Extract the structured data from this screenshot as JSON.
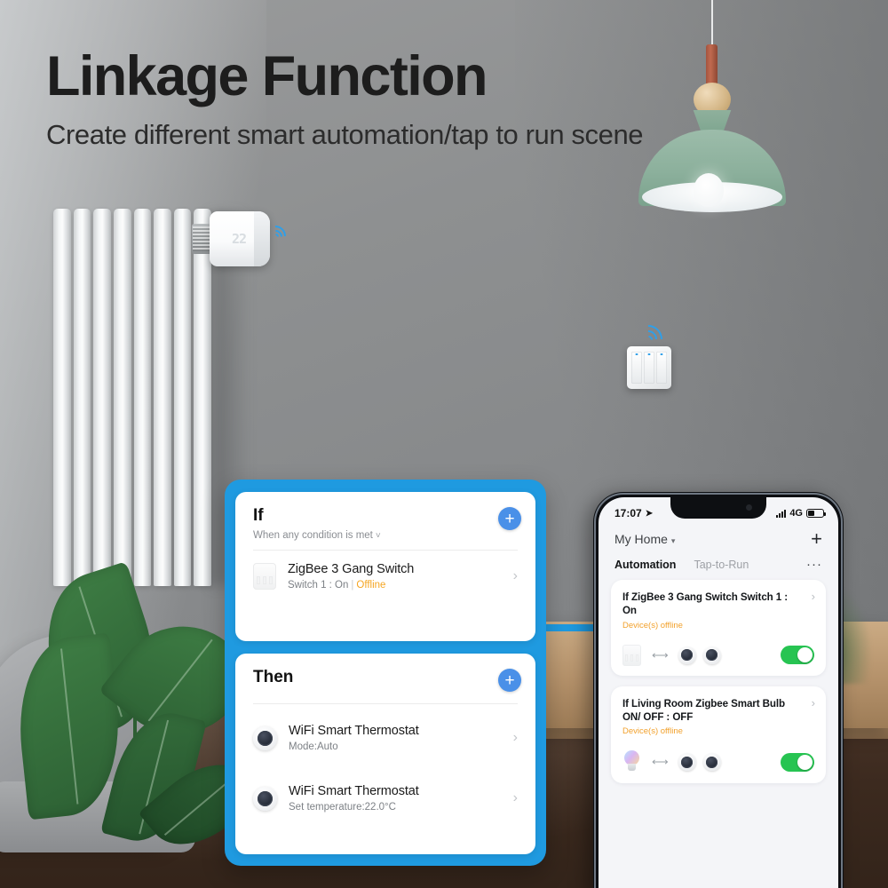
{
  "header": {
    "title": "Linkage Function",
    "subtitle": "Create different smart automation/tap to run scene"
  },
  "scene": {
    "trv_display": "22",
    "wifi_icon": "wifi-icon",
    "wall_switch_icon": "wall-switch-icon",
    "lamp_icon": "pendant-lamp"
  },
  "colors": {
    "accent_blue": "#1f9ae0",
    "plus_blue": "#4a90e8",
    "offline_orange": "#f5a623",
    "toggle_green": "#27c452"
  },
  "blue_panel": {
    "if_card": {
      "title": "If",
      "subtitle": "When any condition is met",
      "chevron": "˅",
      "add_label": "+",
      "rows": [
        {
          "icon": "zigbee-3-gang-switch-icon",
          "title": "ZigBee 3 Gang Switch",
          "sub_main": "Switch 1 : On",
          "sub_sep": "|",
          "sub_status": "Offline",
          "chevron": "›"
        }
      ]
    },
    "then_card": {
      "title": "Then",
      "add_label": "+",
      "rows": [
        {
          "icon": "wifi-thermostat-icon",
          "title": "WiFi Smart Thermostat",
          "sub": "Mode:Auto",
          "chevron": "›"
        },
        {
          "icon": "wifi-thermostat-icon",
          "title": "WiFi Smart Thermostat",
          "sub": "Set temperature:22.0°C",
          "chevron": "›"
        }
      ]
    }
  },
  "phone": {
    "status_bar": {
      "time": "17:07",
      "location_icon": "location-arrow-icon",
      "signal_icon": "signal-bars-icon",
      "network": "4G",
      "battery_icon": "battery-icon"
    },
    "home_bar": {
      "home_name": "My Home",
      "chevron": "▾",
      "add_label": "+"
    },
    "tabs": [
      {
        "label": "Automation",
        "active": true
      },
      {
        "label": "Tap-to-Run",
        "active": false
      }
    ],
    "more_label": "···",
    "automations": [
      {
        "title": "If ZigBee 3 Gang Switch Switch 1 : On",
        "status": "Device(s) offline",
        "chevron": "›",
        "source_icon": "zigbee-3-gang-switch-icon",
        "arrow": "⟷",
        "target_icons": [
          "wifi-thermostat-icon",
          "wifi-thermostat-icon"
        ],
        "enabled": true
      },
      {
        "title": "If  Living Room Zigbee Smart Bulb ON/ OFF : OFF",
        "status": "Device(s) offline",
        "chevron": "›",
        "source_icon": "smart-bulb-icon",
        "arrow": "⟷",
        "target_icons": [
          "wifi-thermostat-icon",
          "wifi-thermostat-icon"
        ],
        "enabled": true
      }
    ]
  }
}
